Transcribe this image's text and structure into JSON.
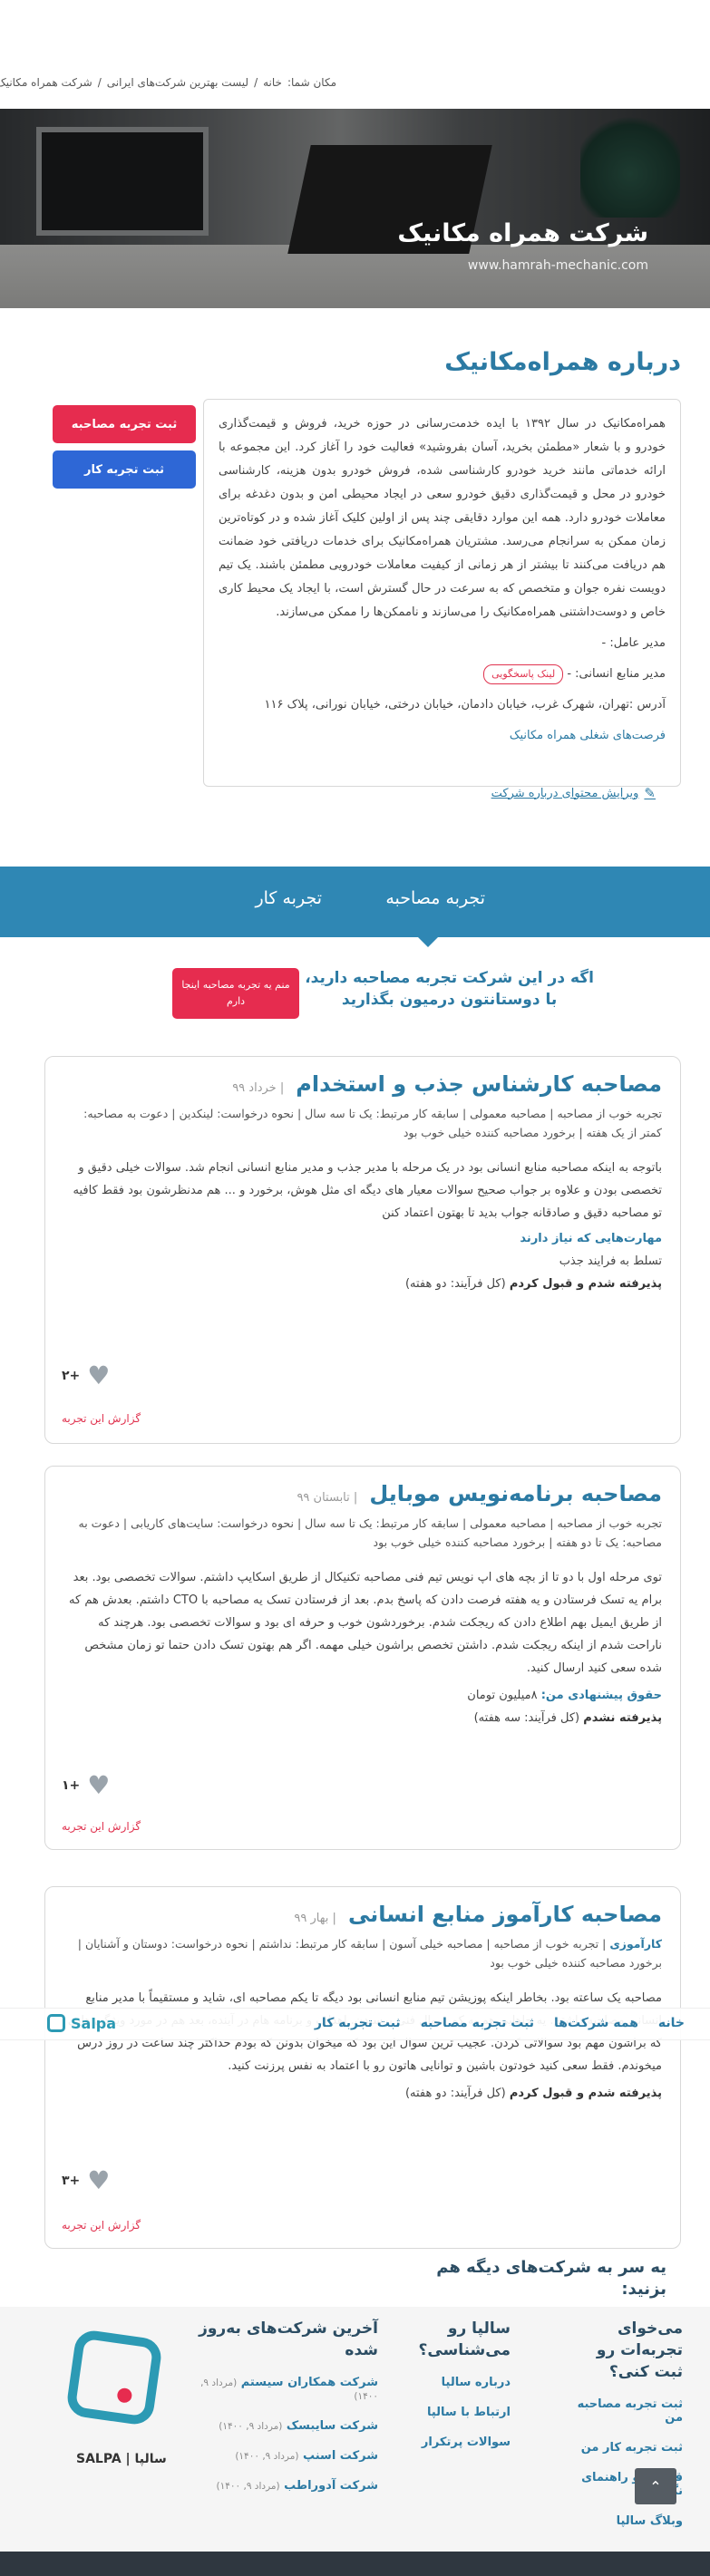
{
  "breadcrumb": {
    "prefix": "مکان شما:",
    "home": "خانه",
    "sep": "/",
    "list": "لیست بهترین شرکت‌های ایرانی",
    "current": "شرکت همراه مکانیک"
  },
  "hero": {
    "title": "شرکت همراه مکانیک",
    "url": "www.hamrah-mechanic.com"
  },
  "about": {
    "title": "درباره همراه‌مکانیک",
    "paragraph": "همراه‌مکانیک در سال ۱۳۹۲ با ایده خدمت‌رسانی در حوزه خرید، فروش و قیمت‌گذاری خودرو و با شعار «مطمئن بخرید، آسان بفروشید» فعالیت خود را آغاز کرد. این مجموعه با ارائه خدماتی مانند خرید خودرو کارشناسی شده، فروش خودرو بدون هزینه، کارشناسی خودرو در محل و قیمت‌گذاری دقیق خودرو سعی در ایجاد محیطی امن و بدون دغدغه برای معاملات خودرو دارد. همه این موارد دقایقی چند پس از اولین کلیک آغاز شده و در کوتاه‌ترین زمان ممکن به سرانجام می‌رسد. مشتریان همراه‌مکانیک برای خدمات دریافتی خود ضمانت هم دریافت می‌کنند تا بیشتر از هر زمانی از کیفیت معاملات خودرویی مطمئن باشند. یک تیم دویست نفره جوان و متخصص که به سرعت در حال گسترش است، با ایجاد یک محیط کاری خاص و دوست‌داشتنی همراه‌مکانیک را می‌سازند و ناممکن‌ها را ممکن می‌سازند.",
    "ceo": "مدیر عامل: -",
    "hr_label": "مدیر منابع انسانی: -",
    "hr_tag": "لینک پاسخگویی",
    "address": "آدرس :تهران، شهرک غرب، خیابان دادمان، خیابان درختی، خیابان نورانی، پلاک ۱۱۶",
    "jobs_link": "فرصت‌های شغلی همراه مکانیک",
    "edit_link": "ویرایش محتوای درباره شرکت"
  },
  "side_buttons": {
    "interview": "ثبت تجربه مصاحبه",
    "work": "ثبت تجربه کار"
  },
  "tabs": {
    "interview": "تجربه مصاحبه",
    "work": "تجربه کار"
  },
  "promo": {
    "line1": "اگه در این شرکت تجربه مصاحبه دارید،",
    "line2": "با دوستانتون درمیون بگذارید",
    "button": "منم یه تجربه مصاحبه اینجا دارم"
  },
  "reviews": [
    {
      "title": "مصاحبه کارشناس جذب و استخدام",
      "date": "| خرداد ۹۹",
      "meta": "تجربه خوب از مصاحبه | مصاحبه معمولی | سابقه کار مرتبط: یک تا سه سال | نحوه درخواست: لینکدین | دعوت به مصاحبه: کمتر از یک هفته | برخورد مصاحبه کننده خیلی خوب بود",
      "body": "باتوجه به اینکه مصاحبه منابع انسانی بود در یک مرحله با مدیر جذب و مدیر منابع انسانی انجام شد. سوالات خیلی دقیق و تخصصی بودن و علاوه بر جواب صحیح سوالات معیار های دیگه ای مثل هوش، برخورد و ... هم مدنظرشون بود فقط کافیه تو مصاحبه دقیق و صادقانه جواب بدید تا بهتون اعتماد کنن",
      "skills_label": "مهارت‌هایی که نیاز دارند",
      "skills": "تسلط به فرایند جذب",
      "result_bold": "پذیرفته شدم و قبول کردم",
      "result_rest": "(کل فرآیند: دو هفته)",
      "likes": "+۲",
      "report": "گزارش این تجربه"
    },
    {
      "title": "مصاحبه برنامه‌نویس موبایل",
      "date": "| تابستان ۹۹",
      "meta": "تجربه خوب از مصاحبه | مصاحبه معمولی | سابقه کار مرتبط: یک تا سه سال | نحوه درخواست: سایت‌های کاریابی | دعوت به مصاحبه: یک تا دو هفته | برخورد مصاحبه کننده خیلی خوب بود",
      "body": "توی مرحله اول با دو تا از بچه های اپ نویس تیم فنی مصاحبه تکنیکال از طریق اسکایپ داشتم. سوالات تخصصی بود. بعد برام یه تسک فرستادن و یه هفته فرصت دادن که پاسخ بدم. بعد از فرستادن تسک یه مصاحبه با CTO داشتم. بعدش هم که از طریق ایمیل بهم اطلاع دادن که ریجکت شدم. برخوردشون خوب و حرفه ای بود و سوالات تخصصی بود. هرچند که ناراحت شدم از اینکه ریجکت شدم. داشتن تخصص براشون خیلی مهمه. اگر هم بهتون تسک دادن حتما تو زمان مشخص شده سعی کنید ارسال کنید.",
      "salary_label": "حقوق پیشنهادی من:",
      "salary": "۸میلیون تومان",
      "result_bold": "پذیرفته نشدم",
      "result_rest": "(کل فرآیند: سه هفته)",
      "likes": "+۱",
      "report": "گزارش این تجربه"
    },
    {
      "title": "مصاحبه کارآموز منابع انسانی",
      "date": "| بهار ۹۹",
      "meta_bold": "کارآموزی",
      "meta": "| تجربه خوب از مصاحبه | مصاحبه خیلی آسون | سابقه کار مرتبط: نداشتم | نحوه درخواست: دوستان و آشنایان | برخورد مصاحبه کننده خیلی خوب بود",
      "body": "مصاحبه یک ساعته بود. بخاطر اینکه پوزیشن تیم منابع انسانی بود دیگه تا یکم مصاحبه ای، شاید و مستقیماً با مدیر منابع انسانی مصاحبه داشتم. یه جاهایی هم یه کم سوال فنی پرسیدن. اهداف و برنامه هام در آینده، بعد هم در مورد ویژگی هایی که براشون مهم بود سوالاتی کردن. عجیب ترین سوال این بود که میخوان بدونن که بودم حداکثر چند ساعت در روز درس میخوندم. فقط سعی کنید خودتون باشین و توانایی هاتون رو با اعتماد به نفس پرزنت کنید.",
      "result_bold": "پذیرفته شدم و قبول کردم",
      "result_rest": "(کل فرآیند: دو هفته)",
      "likes": "+۳",
      "report": "گزارش این تجربه"
    }
  ],
  "floating_nav": {
    "items": [
      "خانه",
      "همه شرکت‌ها",
      "ثبت تجربه مصاحبه",
      "ثبت تجربه کار"
    ],
    "logo": "Salpa"
  },
  "other_companies_title": "یه سر به شرکت‌های دیگه هم بزنید:",
  "footer": {
    "col1": {
      "title": "می‌خوای تجربه‌ات رو ثبت کنی؟",
      "items": [
        "ثبت تجربه مصاحبه من",
        "ثبت تجربه کار من",
        "قوانین و راهنمای نگارش",
        "وبلاگ سالپا"
      ]
    },
    "col2": {
      "title": "سالپا رو می‌شناسی؟",
      "items": [
        "درباره سالپا",
        "ارتباط با سالپا",
        "سوالات پرتکرار"
      ]
    },
    "col3": {
      "title": "آخرین شرکت‌های به‌روز شده",
      "items": [
        {
          "name": "شرکت همکاران سیستم",
          "date": "(مرداد ۹, ۱۴۰۰)"
        },
        {
          "name": "شرکت سایبسک",
          "date": "(مرداد ۹, ۱۴۰۰)"
        },
        {
          "name": "شرکت اسنپ",
          "date": "(مرداد ۹, ۱۴۰۰)"
        },
        {
          "name": "شرکت آدوراطب",
          "date": "(مرداد ۹, ۱۴۰۰)"
        }
      ]
    },
    "brand": "SALPA | سالپا"
  },
  "colors": {
    "primary": "#2c7aa3",
    "accent_red": "#e62c4f",
    "accent_blue": "#2e67d6",
    "tabbar": "#2f87b4"
  }
}
